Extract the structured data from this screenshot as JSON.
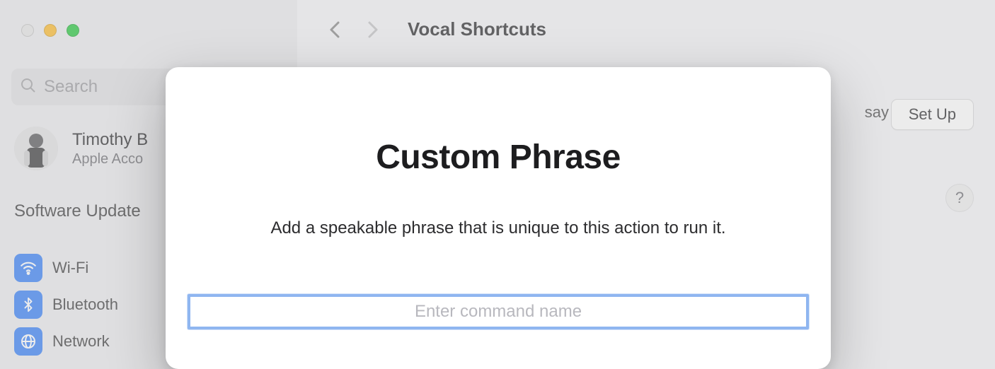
{
  "window": {
    "traffic_light_colors": {
      "close": "#e6e6e6",
      "minimize": "#febc2e",
      "maximize": "#28c840"
    }
  },
  "sidebar": {
    "search_placeholder": "Search",
    "account": {
      "name": "Timothy B",
      "sub": "Apple Acco"
    },
    "software_update": "Software Update ",
    "items": [
      {
        "label": "Wi-Fi",
        "icon": "wifi-icon"
      },
      {
        "label": "Bluetooth",
        "icon": "bluetooth-icon"
      },
      {
        "label": "Network",
        "icon": "network-icon"
      }
    ]
  },
  "content": {
    "page_title": "Vocal Shortcuts",
    "say_fragment": "say",
    "setup_button": "Set Up",
    "help": "?"
  },
  "modal": {
    "title": "Custom Phrase",
    "description": "Add a speakable phrase that is unique to this action to run it.",
    "input_placeholder": "Enter command name"
  }
}
